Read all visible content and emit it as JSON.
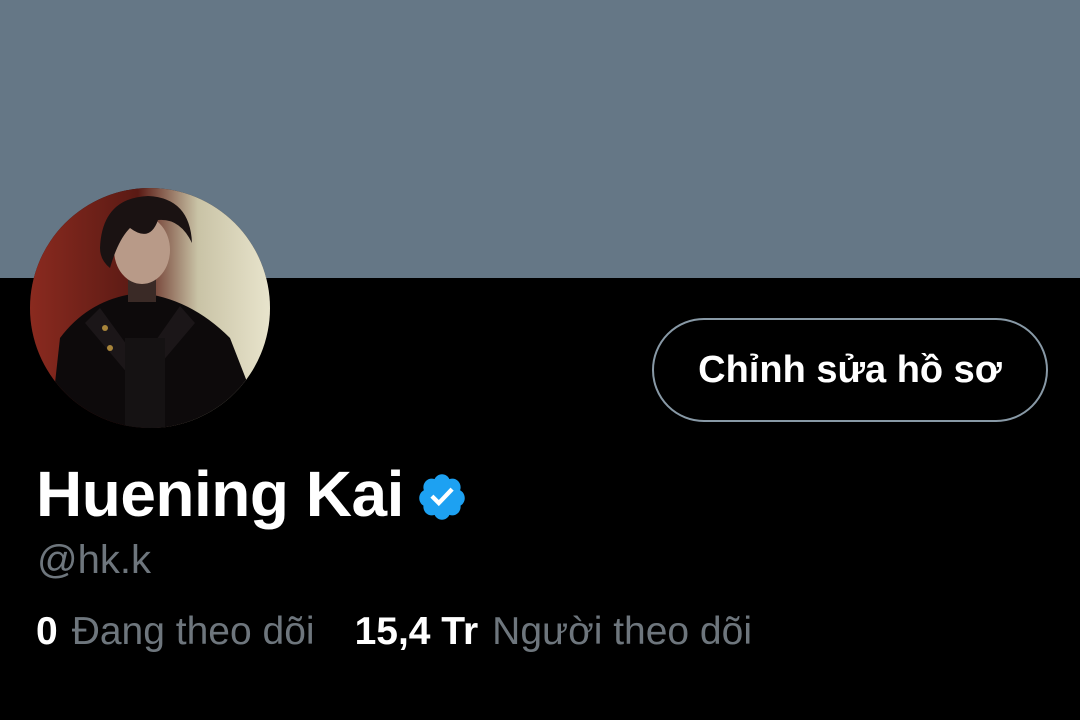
{
  "profile": {
    "display_name": "Huening Kai",
    "handle": "@hk.k",
    "verified": true,
    "avatar_icon": "profile-photo",
    "verified_icon": "verified-badge-icon"
  },
  "actions": {
    "edit_profile_label": "Chỉnh sửa hồ sơ"
  },
  "stats": {
    "following_count": "0",
    "following_label": "Đang theo dõi",
    "followers_count": "15,4 Tr",
    "followers_label": "Người theo dõi"
  },
  "colors": {
    "banner": "#657786",
    "background": "#000000",
    "verified": "#1da1f2",
    "secondary_text": "#6e767d",
    "button_border": "#8899a6"
  }
}
